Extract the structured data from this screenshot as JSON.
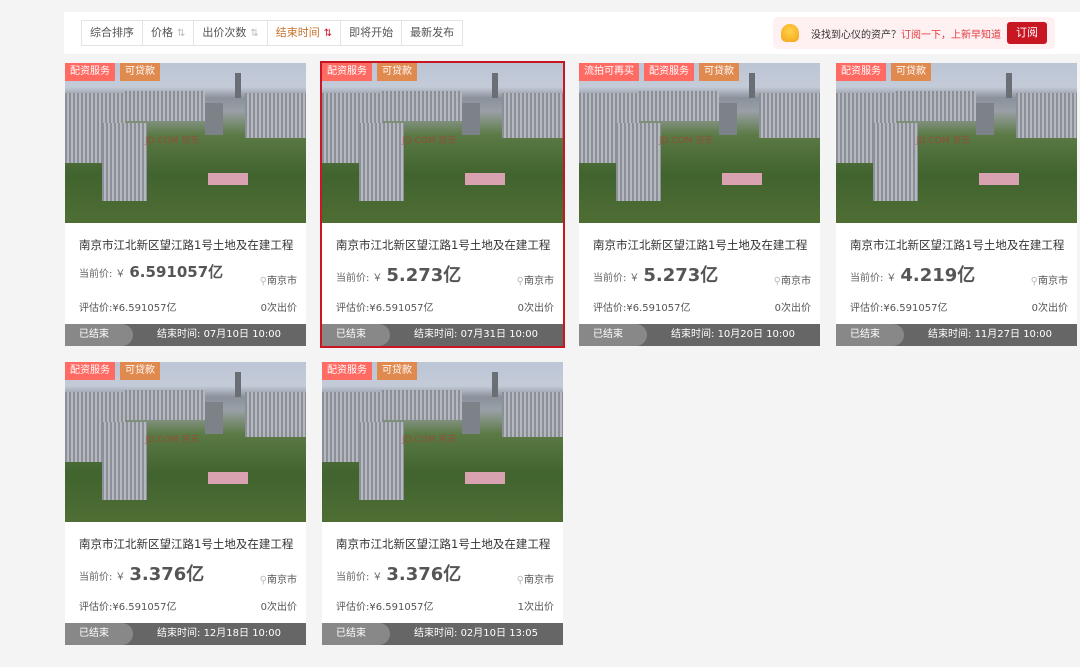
{
  "sort_bar": {
    "items": [
      {
        "label": "综合排序",
        "arrow": ""
      },
      {
        "label": "价格",
        "arrow": "⇅"
      },
      {
        "label": "出价次数",
        "arrow": "⇅"
      },
      {
        "label": "结束时间",
        "arrow": "⇅",
        "active": true
      },
      {
        "label": "即将开始",
        "arrow": ""
      },
      {
        "label": "最新发布",
        "arrow": ""
      }
    ]
  },
  "subscribe": {
    "icon": "bell-icon",
    "text": "没找到心仪的资产？",
    "highlight": "订阅一下，上新早知道",
    "button": "订阅"
  },
  "colors": {
    "accent": "#c81623",
    "tag_red": "#ff6a63",
    "tag_orange": "#e08a50",
    "active_sort": "#c7742b"
  },
  "labels": {
    "current_price": "当前价:",
    "yen": "￥",
    "end_prefix": "结束时间: ",
    "watermark": "JD.COM 京东"
  },
  "cards": [
    {
      "tags": [
        "配资服务",
        "可贷款"
      ],
      "title": "南京市江北新区望江路1号土地及在建工程",
      "price": "6.591057亿",
      "location": "南京市",
      "estimate": "评估价:¥6.591057亿",
      "bids": "0次出价",
      "status": "已结束",
      "end": "07月10日 10:00"
    },
    {
      "tags": [
        "配资服务",
        "可贷款"
      ],
      "title": "南京市江北新区望江路1号土地及在建工程",
      "price": "5.273亿",
      "location": "南京市",
      "estimate": "评估价:¥6.591057亿",
      "bids": "0次出价",
      "status": "已结束",
      "end": "07月31日 10:00",
      "selected": true
    },
    {
      "tags": [
        "流拍可再买",
        "配资服务",
        "可贷款"
      ],
      "title": "南京市江北新区望江路1号土地及在建工程",
      "price": "5.273亿",
      "location": "南京市",
      "estimate": "评估价:¥6.591057亿",
      "bids": "0次出价",
      "status": "已结束",
      "end": "10月20日 10:00"
    },
    {
      "tags": [
        "配资服务",
        "可贷款"
      ],
      "title": "南京市江北新区望江路1号土地及在建工程",
      "price": "4.219亿",
      "location": "南京市",
      "estimate": "评估价:¥6.591057亿",
      "bids": "0次出价",
      "status": "已结束",
      "end": "11月27日 10:00"
    },
    {
      "tags": [
        "配资服务",
        "可贷款"
      ],
      "title": "南京市江北新区望江路1号土地及在建工程",
      "price": "3.376亿",
      "location": "南京市",
      "estimate": "评估价:¥6.591057亿",
      "bids": "0次出价",
      "status": "已结束",
      "end": "12月18日 10:00"
    },
    {
      "tags": [
        "配资服务",
        "可贷款"
      ],
      "title": "南京市江北新区望江路1号土地及在建工程",
      "price": "3.376亿",
      "location": "南京市",
      "estimate": "评估价:¥6.591057亿",
      "bids": "1次出价",
      "status": "已结束",
      "end": "02月10日 13:05"
    }
  ]
}
